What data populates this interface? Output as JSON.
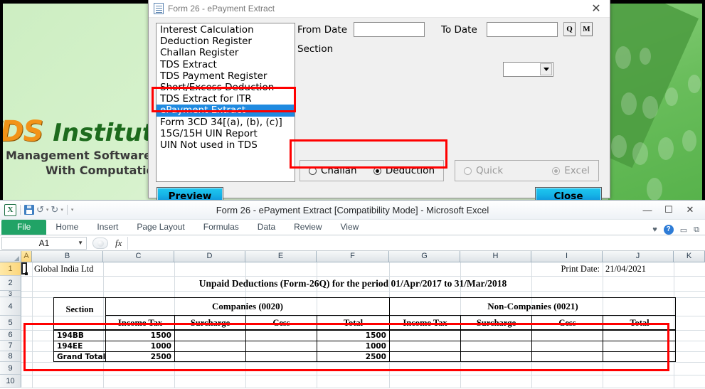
{
  "background_app": {
    "logo_tds": "TDS",
    "logo_institute": "Institute",
    "tagline1": "Management Software",
    "tagline2": "With Computation"
  },
  "dialog": {
    "title": "Form 26 - ePayment Extract",
    "close_icon": "✕",
    "doc_icon": "document-icon",
    "report_list": [
      {
        "label": "Interest Calculation",
        "selected": false
      },
      {
        "label": "Deduction Register",
        "selected": false
      },
      {
        "label": "Challan Register",
        "selected": false
      },
      {
        "label": "TDS Extract",
        "selected": false
      },
      {
        "label": "TDS Payment Register",
        "selected": false
      },
      {
        "label": "Short/Excess Deduction",
        "selected": false
      },
      {
        "label": "TDS Extract for ITR",
        "selected": false
      },
      {
        "label": "ePayment Extract",
        "selected": true
      },
      {
        "label": "Form 3CD 34[(a), (b), (c)]",
        "selected": false
      },
      {
        "label": "15G/15H UIN Report",
        "selected": false
      },
      {
        "label": "UIN Not used in TDS",
        "selected": false
      }
    ],
    "from_date_label": "From Date",
    "from_date_value": "",
    "to_date_label": "To Date",
    "to_date_value": "",
    "section_label": "Section",
    "section_value": "",
    "quarter_button": "Q",
    "month_button": "M",
    "mode_options": [
      {
        "label": "Challan",
        "selected": false,
        "disabled": false
      },
      {
        "label": "Deduction",
        "selected": true,
        "disabled": false
      }
    ],
    "output_options": [
      {
        "label": "Quick",
        "selected": false,
        "disabled": true
      },
      {
        "label": "Excel",
        "selected": true,
        "disabled": true
      }
    ],
    "preview_button": {
      "accel": "P",
      "rest": "review"
    },
    "close_button": {
      "accel": "C",
      "rest": "lose"
    }
  },
  "excel": {
    "title": "Form 26 - ePayment Extract  [Compatibility Mode]  -  Microsoft Excel",
    "logo": "X",
    "quick_access": [
      "save-icon",
      "undo-icon",
      "redo-icon",
      "customize-icon"
    ],
    "window_buttons": [
      "minimize-button",
      "maximize-button",
      "close-button"
    ],
    "ribbon_tabs": [
      "File",
      "Home",
      "Insert",
      "Page Layout",
      "Formulas",
      "Data",
      "Review",
      "View"
    ],
    "ribbon_right_icons": [
      "ribbon-options-icon",
      "help-icon",
      "minimize-ribbon-icon",
      "restore-window-icon"
    ],
    "help_glyph": "?",
    "name_box": "A1",
    "formula_value": "",
    "fx_label": "fx",
    "column_headers": [
      "A",
      "B",
      "C",
      "D",
      "E",
      "F",
      "G",
      "H",
      "I",
      "J",
      "K"
    ],
    "active_column": "A",
    "row_headers": [
      "1",
      "2",
      "3",
      "4",
      "5",
      "6",
      "7",
      "8",
      "9",
      "10"
    ],
    "active_row": "1",
    "sheet": {
      "company_name": "Global India Ltd",
      "print_date_label": "Print Date:",
      "print_date_value": "21/04/2021",
      "report_title": "Unpaid Deductions (Form-26Q) for the period 01/Apr/2017 to 31/Mar/2018",
      "section_header": "Section",
      "group_headers": [
        "Companies (0020)",
        "Non-Companies (0021)"
      ],
      "column_headers": [
        "Income Tax",
        "Surcharge",
        "Cess",
        "Total",
        "Income Tax",
        "Surcharge",
        "Cess",
        "Total"
      ],
      "rows": [
        {
          "section": "194BB",
          "c_income_tax": "1500",
          "c_surcharge": "",
          "c_cess": "",
          "c_total": "1500",
          "n_income_tax": "",
          "n_surcharge": "",
          "n_cess": "",
          "n_total": ""
        },
        {
          "section": "194EE",
          "c_income_tax": "1000",
          "c_surcharge": "",
          "c_cess": "",
          "c_total": "1000",
          "n_income_tax": "",
          "n_surcharge": "",
          "n_cess": "",
          "n_total": ""
        },
        {
          "section": "Grand Total",
          "c_income_tax": "2500",
          "c_surcharge": "",
          "c_cess": "",
          "c_total": "2500",
          "n_income_tax": "",
          "n_surcharge": "",
          "n_cess": "",
          "n_total": ""
        }
      ]
    }
  },
  "annotations": {
    "highlight_color": "#ff0000",
    "boxes": [
      "selected-list-item",
      "mode-radio-group",
      "result-table"
    ]
  }
}
